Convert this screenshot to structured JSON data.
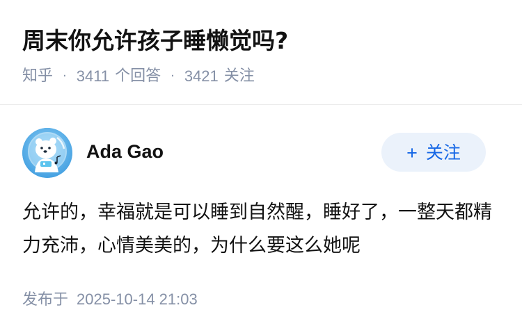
{
  "question": {
    "title": "周末你允许孩子睡懒觉吗?",
    "source": "知乎",
    "answer_count": "3411",
    "answer_count_label": "个回答",
    "follower_count": "3421",
    "follower_label": "关注",
    "separator": "·"
  },
  "author": {
    "name": "Ada Gao",
    "follow_plus": "+",
    "follow_label": "关注",
    "avatar_icon": "polar-bear-astronaut-avatar"
  },
  "answer": {
    "content": "允许的，幸福就是可以睡到自然醒，睡好了，一整天都精力充沛，心情美美的，为什么要这么她呢",
    "published_label": "发布于",
    "published_date": "2025-10-14 21:03"
  },
  "colors": {
    "title": "#121212",
    "meta": "#8590a6",
    "follow_bg": "#ebf2fb",
    "follow_text": "#1768e6",
    "avatar_bg": "#5aaee8"
  }
}
